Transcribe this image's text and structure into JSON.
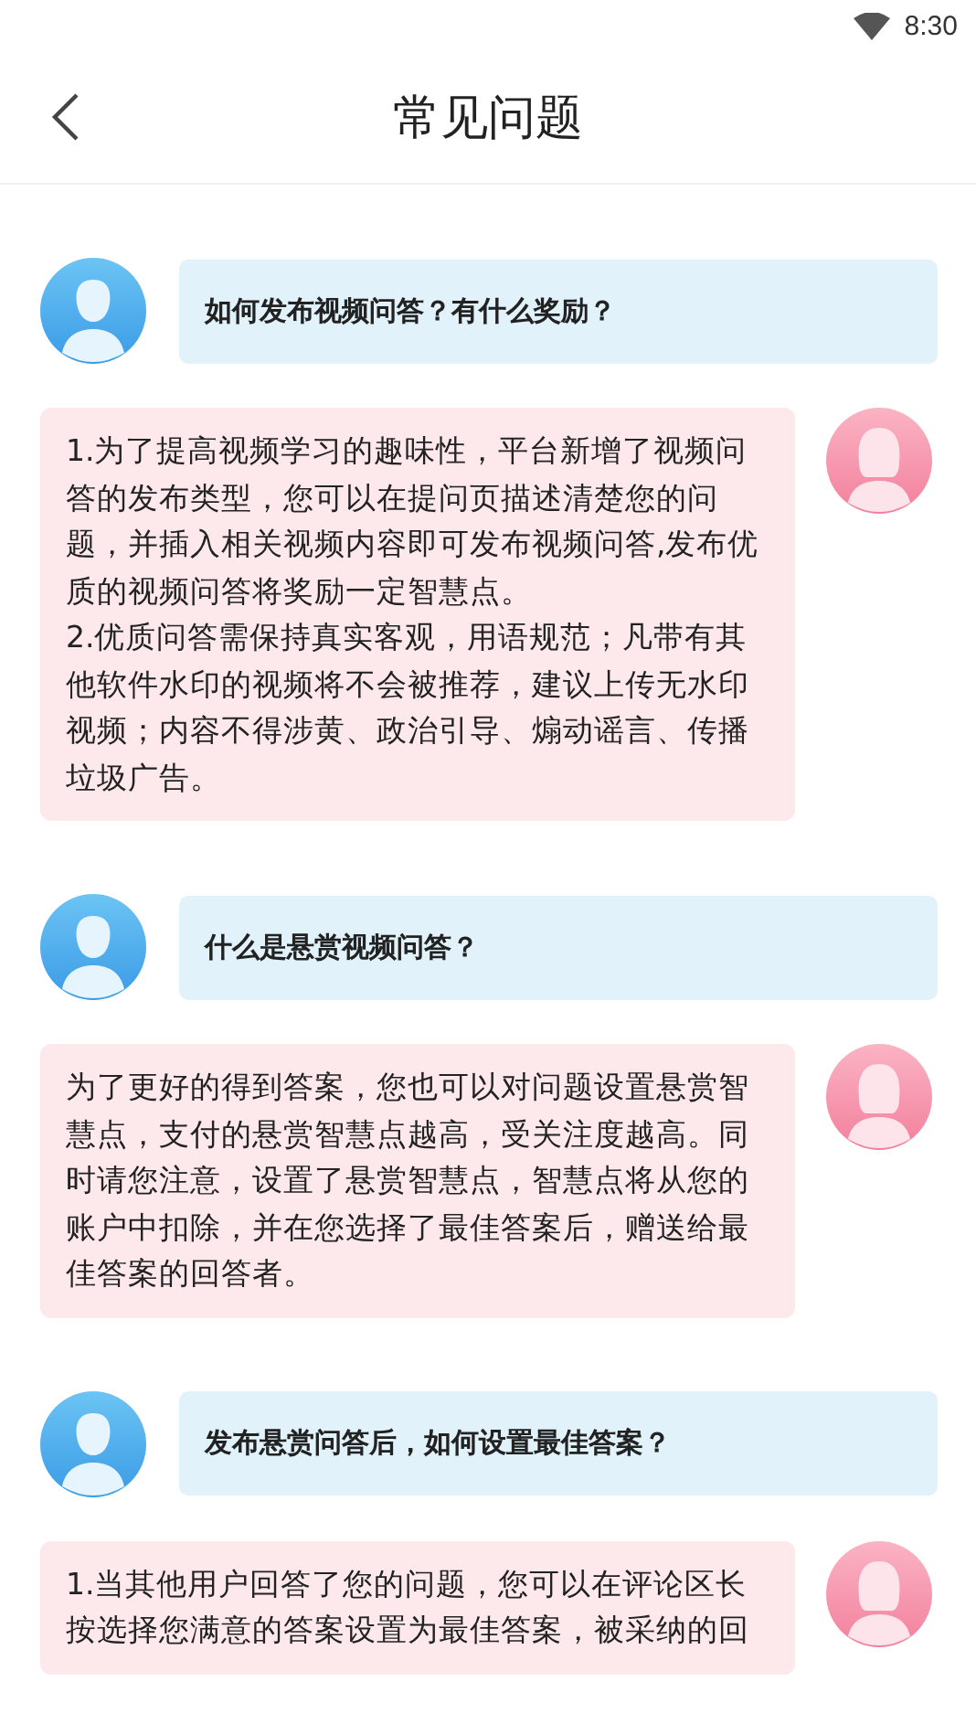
{
  "status_bar": {
    "time": "8:30"
  },
  "header": {
    "title": "常见问题"
  },
  "faqs": [
    {
      "question": "如何发布视频问答？有什么奖励？",
      "answer": "1.为了提高视频学习的趣味性，平台新增了视频问答的发布类型，您可以在提问页描述清楚您的问题，并插入相关视频内容即可发布视频问答,发布优质的视频问答将奖励一定智慧点。\n2.优质问答需保持真实客观，用语规范；凡带有其他软件水印的视频将不会被推荐，建议上传无水印视频；内容不得涉黄、政治引导、煽动谣言、传播垃圾广告。"
    },
    {
      "question": "什么是悬赏视频问答？",
      "answer": "为了更好的得到答案，您也可以对问题设置悬赏智慧点，支付的悬赏智慧点越高，受关注度越高。同时请您注意，设置了悬赏智慧点，智慧点将从您的账户中扣除，并在您选择了最佳答案后，赠送给最佳答案的回答者。"
    },
    {
      "question": "发布悬赏问答后，如何设置最佳答案？",
      "answer": "1.当其他用户回答了您的问题，您可以在评论区长按选择您满意的答案设置为最佳答案，被采纳的回"
    }
  ]
}
